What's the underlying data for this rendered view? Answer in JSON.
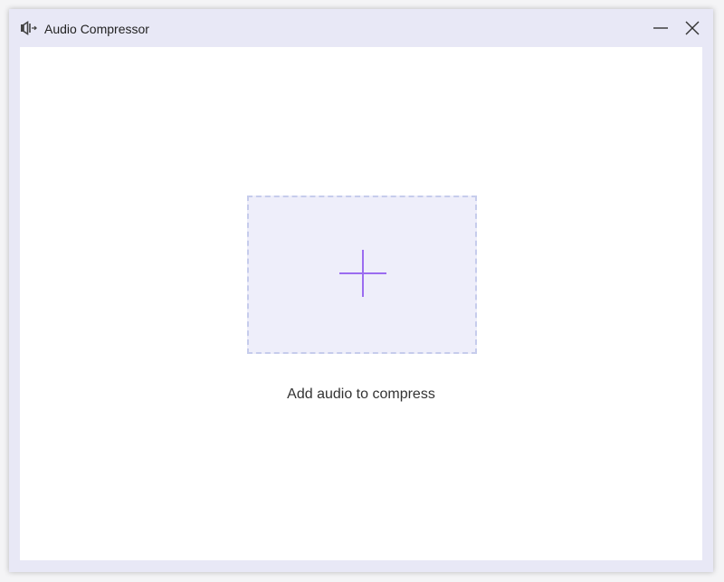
{
  "window": {
    "title": "Audio Compressor",
    "icon": "speaker-compress-icon"
  },
  "controls": {
    "minimize_icon": "minimize-icon",
    "close_icon": "close-icon"
  },
  "main": {
    "drop_zone_icon": "plus-icon",
    "drop_label": "Add audio to compress"
  },
  "colors": {
    "titlebar": "#e8e8f6",
    "drop_zone_bg": "#eeeefa",
    "drop_zone_border": "#c6ccec",
    "accent": "#9b6cf0"
  }
}
